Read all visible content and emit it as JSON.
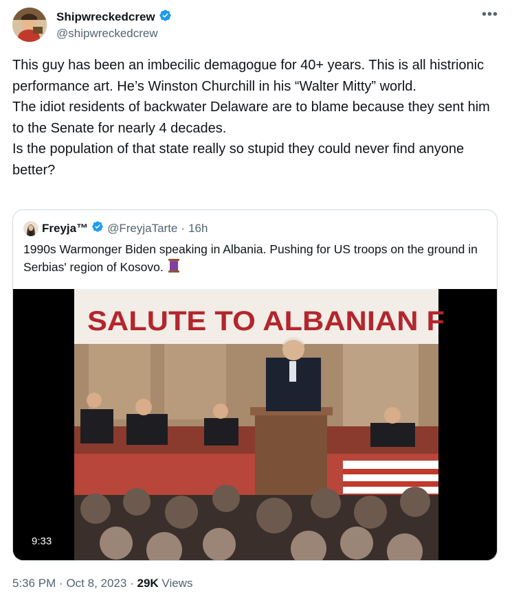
{
  "author": {
    "display_name": "Shipwreckedcrew",
    "handle": "@shipwreckedcrew",
    "verified_icon": "verified-badge-icon"
  },
  "more_icon": "more-options-icon",
  "tweet": {
    "lines": [
      "This guy has been an imbecilic demagogue for 40+ years.  This is all histrionic performance art.  He’s Winston Churchill in his “Walter Mitty” world.",
      "The idiot residents of backwater Delaware are to blame because they sent him to the Senate for  nearly 4 decades.",
      "Is the population of that state really so stupid they could never find anyone better?"
    ]
  },
  "quote": {
    "display_name": "Freyja™",
    "handle": "@FreyjaTarte",
    "separator": "·",
    "time": "16h",
    "text": "1990s Warmonger Biden speaking in Albania.  Pushing for US troops on the ground in Serbias' region of Kosovo.",
    "emoji": "spool-of-thread-icon",
    "video": {
      "banner_text": "SALUTE TO ALBANIAN F",
      "duration": "9:33"
    }
  },
  "footer": {
    "time": "5:36 PM",
    "date": "Oct 8, 2023",
    "sep": "·",
    "views_count": "29K",
    "views_label": "Views"
  },
  "colors": {
    "text": "#0f1419",
    "secondary": "#536471",
    "verified": "#1d9bf0",
    "border": "#cfd9de",
    "banner_red": "#b3262d"
  }
}
